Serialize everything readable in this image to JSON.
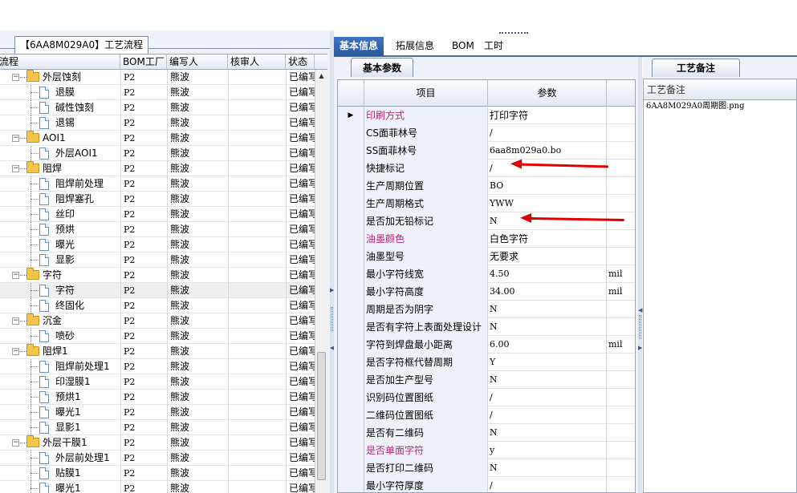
{
  "left_panel": {
    "flow_tab_label": "【6AA8M029A0】工艺流程",
    "columns": [
      "流程",
      "BOM工厂",
      "编写人",
      "核审人",
      "状态"
    ],
    "rows": [
      {
        "name": "外层蚀刻",
        "type": "folder",
        "level": 0,
        "toggle": "−",
        "factory": "P2",
        "author": "熊波",
        "reviewer": "",
        "status": "已编写"
      },
      {
        "name": "退膜",
        "type": "doc",
        "level": 1,
        "factory": "P2",
        "author": "熊波",
        "reviewer": "",
        "status": "已编写"
      },
      {
        "name": "碱性蚀刻",
        "type": "doc",
        "level": 1,
        "factory": "P2",
        "author": "熊波",
        "reviewer": "",
        "status": "已编写"
      },
      {
        "name": "退锡",
        "type": "doc",
        "level": 1,
        "factory": "P2",
        "author": "熊波",
        "reviewer": "",
        "status": "已编写"
      },
      {
        "name": "AOI1",
        "type": "folder",
        "level": 0,
        "toggle": "−",
        "factory": "P2",
        "author": "熊波",
        "reviewer": "",
        "status": "已编写"
      },
      {
        "name": "外层AOI1",
        "type": "doc",
        "level": 1,
        "factory": "P2",
        "author": "熊波",
        "reviewer": "",
        "status": "已编写"
      },
      {
        "name": "阻焊",
        "type": "folder",
        "level": 0,
        "toggle": "−",
        "factory": "P2",
        "author": "熊波",
        "reviewer": "",
        "status": "已编写"
      },
      {
        "name": "阻焊前处理",
        "type": "doc",
        "level": 1,
        "factory": "P2",
        "author": "熊波",
        "reviewer": "",
        "status": "已编写"
      },
      {
        "name": "阻焊塞孔",
        "type": "doc",
        "level": 1,
        "factory": "P2",
        "author": "熊波",
        "reviewer": "",
        "status": "已编写"
      },
      {
        "name": "丝印",
        "type": "doc",
        "level": 1,
        "factory": "P2",
        "author": "熊波",
        "reviewer": "",
        "status": "已编写"
      },
      {
        "name": "预烘",
        "type": "doc",
        "level": 1,
        "factory": "P2",
        "author": "熊波",
        "reviewer": "",
        "status": "已编写"
      },
      {
        "name": "曝光",
        "type": "doc",
        "level": 1,
        "factory": "P2",
        "author": "熊波",
        "reviewer": "",
        "status": "已编写"
      },
      {
        "name": "显影",
        "type": "doc",
        "level": 1,
        "factory": "P2",
        "author": "熊波",
        "reviewer": "",
        "status": "已编写"
      },
      {
        "name": "字符",
        "type": "folder",
        "level": 0,
        "toggle": "−",
        "factory": "P2",
        "author": "熊波",
        "reviewer": "",
        "status": "已编写"
      },
      {
        "name": "字符",
        "type": "doc",
        "level": 1,
        "selected": true,
        "factory": "P2",
        "author": "熊波",
        "reviewer": "",
        "status": "已编写"
      },
      {
        "name": "终固化",
        "type": "doc",
        "level": 1,
        "factory": "P2",
        "author": "熊波",
        "reviewer": "",
        "status": "已编写"
      },
      {
        "name": "沉金",
        "type": "folder",
        "level": 0,
        "toggle": "−",
        "factory": "P2",
        "author": "熊波",
        "reviewer": "",
        "status": "已编写"
      },
      {
        "name": "喷砂",
        "type": "doc",
        "level": 1,
        "factory": "P2",
        "author": "熊波",
        "reviewer": "",
        "status": "已编写"
      },
      {
        "name": "阻焊1",
        "type": "folder",
        "level": 0,
        "toggle": "−",
        "factory": "P2",
        "author": "熊波",
        "reviewer": "",
        "status": "已编写"
      },
      {
        "name": "阻焊前处理1",
        "type": "doc",
        "level": 1,
        "factory": "P2",
        "author": "熊波",
        "reviewer": "",
        "status": "已编写"
      },
      {
        "name": "印湿膜1",
        "type": "doc",
        "level": 1,
        "factory": "P2",
        "author": "熊波",
        "reviewer": "",
        "status": "已编写"
      },
      {
        "name": "预烘1",
        "type": "doc",
        "level": 1,
        "factory": "P2",
        "author": "熊波",
        "reviewer": "",
        "status": "已编写"
      },
      {
        "name": "曝光1",
        "type": "doc",
        "level": 1,
        "factory": "P2",
        "author": "熊波",
        "reviewer": "",
        "status": "已编写"
      },
      {
        "name": "显影1",
        "type": "doc",
        "level": 1,
        "factory": "P2",
        "author": "熊波",
        "reviewer": "",
        "status": "已编写"
      },
      {
        "name": "外层干膜1",
        "type": "folder",
        "level": 0,
        "toggle": "−",
        "factory": "P2",
        "author": "熊波",
        "reviewer": "",
        "status": "已编写"
      },
      {
        "name": "外层前处理1",
        "type": "doc",
        "level": 1,
        "factory": "P2",
        "author": "熊波",
        "reviewer": "",
        "status": "已编写"
      },
      {
        "name": "贴膜1",
        "type": "doc",
        "level": 1,
        "factory": "P2",
        "author": "熊波",
        "reviewer": "",
        "status": "已编写"
      },
      {
        "name": "曝光1",
        "type": "doc",
        "level": 1,
        "factory": "P2",
        "author": "熊波",
        "reviewer": "",
        "status": "已编写"
      }
    ]
  },
  "top_tabs": [
    {
      "label": "基本信息",
      "active": true
    },
    {
      "label": "拓展信息",
      "active": false
    },
    {
      "label": "BOM",
      "active": false
    },
    {
      "label": "工时",
      "active": false
    }
  ],
  "base_params": {
    "tab_label": "基本参数",
    "col_item": "项目",
    "col_param": "参数",
    "rows": [
      {
        "item": "印刷方式",
        "value": "打印字符",
        "unit": "",
        "highlight": true,
        "current": true
      },
      {
        "item": "CS面菲林号",
        "value": "/",
        "unit": ""
      },
      {
        "item": "SS面菲林号",
        "value": "6aa8m029a0.bo",
        "unit": ""
      },
      {
        "item": "快捷标记",
        "value": "/",
        "unit": ""
      },
      {
        "item": "生产周期位置",
        "value": "BO",
        "unit": ""
      },
      {
        "item": "生产周期格式",
        "value": "YWW",
        "unit": ""
      },
      {
        "item": "是否加无铅标记",
        "value": "N",
        "unit": ""
      },
      {
        "item": "油墨颜色",
        "value": "白色字符",
        "unit": "",
        "highlight": true
      },
      {
        "item": "油墨型号",
        "value": "无要求",
        "unit": ""
      },
      {
        "item": "最小字符线宽",
        "value": "4.50",
        "unit": "mil"
      },
      {
        "item": "最小字符高度",
        "value": "34.00",
        "unit": "mil"
      },
      {
        "item": "周期是否为阴字",
        "value": "N",
        "unit": ""
      },
      {
        "item": "是否有字符上表面处理设计",
        "value": "N",
        "unit": ""
      },
      {
        "item": "字符到焊盘最小距离",
        "value": "6.00",
        "unit": "mil"
      },
      {
        "item": "是否字符框代替周期",
        "value": "Y",
        "unit": ""
      },
      {
        "item": "是否加生产型号",
        "value": "N",
        "unit": ""
      },
      {
        "item": "识别码位置图纸",
        "value": "/",
        "unit": ""
      },
      {
        "item": "二维码位置图纸",
        "value": "/",
        "unit": ""
      },
      {
        "item": "是否有二维码",
        "value": "N",
        "unit": ""
      },
      {
        "item": "是否单面字符",
        "value": "y",
        "unit": "",
        "highlight": true
      },
      {
        "item": "是否打印二维码",
        "value": "N",
        "unit": ""
      },
      {
        "item": "最小字符厚度",
        "value": "/",
        "unit": ""
      }
    ]
  },
  "process_remark": {
    "tab_label": "工艺备注",
    "header": "工艺备注",
    "value": "6AA8M029A0周期图.png"
  },
  "colors": {
    "highlight_text": "#b5287a",
    "active_tab": "#2f63b0",
    "annotation_arrow": "#e00000"
  }
}
